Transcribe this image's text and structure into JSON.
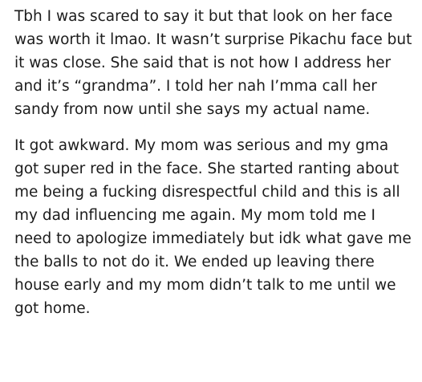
{
  "post": {
    "paragraphs": [
      "Tbh I was scared to say it but that look on her face was worth it lmao. It wasn’t surprise Pikachu face but it was close. She said that is not how I address her and it’s “grandma”. I told her nah I’mma call her sandy from now until she says my actual name.",
      "It got awkward. My mom was serious and my gma got super red in the face. She started ranting about me being a fucking disrespectful child and this is all my dad influencing me again. My mom told me I need to apologize immediately but idk what gave me the balls to not do it. We ended up leaving there house early and my mom didn’t talk to me until we got home."
    ]
  }
}
